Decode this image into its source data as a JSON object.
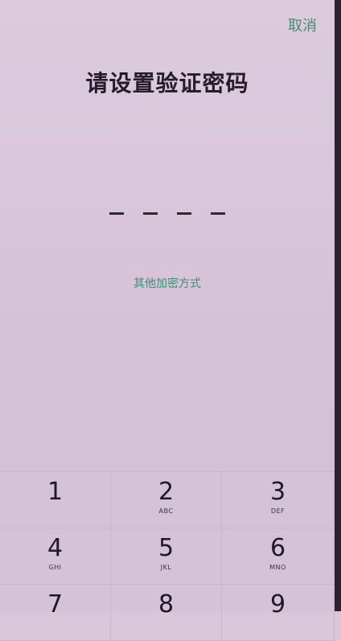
{
  "header": {
    "cancel_label": "取消"
  },
  "main": {
    "title": "请设置验证密码",
    "pin_length": 4,
    "other_methods_label": "其他加密方式"
  },
  "keypad": {
    "keys": [
      {
        "digit": "1",
        "letters": ""
      },
      {
        "digit": "2",
        "letters": "ABC"
      },
      {
        "digit": "3",
        "letters": "DEF"
      },
      {
        "digit": "4",
        "letters": "GHI"
      },
      {
        "digit": "5",
        "letters": "JKL"
      },
      {
        "digit": "6",
        "letters": "MNO"
      },
      {
        "digit": "7",
        "letters": ""
      },
      {
        "digit": "8",
        "letters": ""
      },
      {
        "digit": "9",
        "letters": ""
      }
    ]
  },
  "colors": {
    "accent": "#3f8f73",
    "background": "#d9c6d9",
    "text": "#241d28"
  }
}
